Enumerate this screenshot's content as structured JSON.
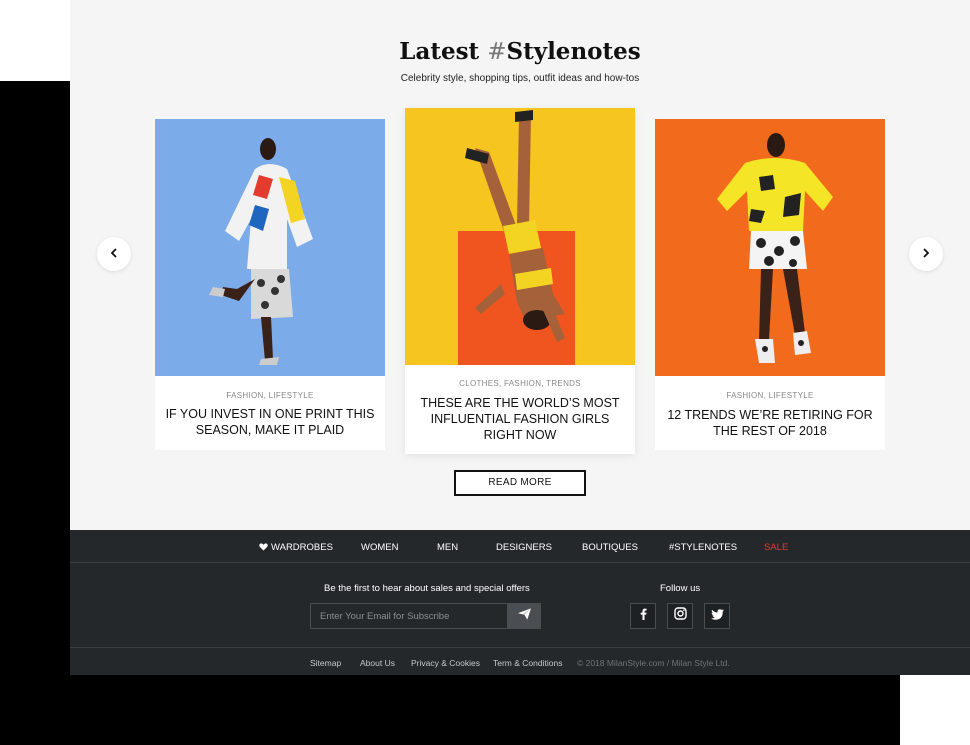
{
  "section": {
    "heading_main": "Latest ",
    "heading_hash": "#",
    "heading_word": "Stylenotes",
    "subheading": "Celebrity style, shopping tips, outfit ideas and how-tos"
  },
  "carousel": {
    "cards": [
      {
        "categories": "FASHION, LIFESTYLE",
        "title": "IF YOU INVEST IN ONE PRINT THIS SEASON, MAKE IT PLAID"
      },
      {
        "categories": "CLOTHES, FASHION, TRENDS",
        "title": "THESE ARE THE WORLD’S MOST INFLUENTIAL FASHION GIRLS RIGHT NOW"
      },
      {
        "categories": "FASHION, LIFESTYLE",
        "title": "12 TRENDS WE’RE RETIRING FOR THE REST OF 2018"
      }
    ],
    "prev_icon": "chevron-left-icon",
    "next_icon": "chevron-right-icon"
  },
  "read_more_label": "READ MORE",
  "footer": {
    "nav": [
      {
        "label": "WARDROBES",
        "icon": "heart-icon"
      },
      {
        "label": "WOMEN"
      },
      {
        "label": "MEN"
      },
      {
        "label": "DESIGNERS"
      },
      {
        "label": "BOUTIQUES"
      },
      {
        "label": "#STYLENOTES"
      },
      {
        "label": "SALE",
        "color": "#e53935"
      }
    ],
    "newsletter_label": "Be the first to hear about sales and special offers",
    "email_placeholder": "Enter Your Email for Subscribe",
    "email_value": "",
    "send_icon": "paper-plane-icon",
    "follow_label": "Follow us",
    "social": [
      "facebook-icon",
      "instagram-icon",
      "twitter-icon"
    ],
    "links": [
      "Sitemap",
      "About Us",
      "Privacy & Cookies",
      "Term & Conditions"
    ],
    "copyright": "© 2018 MilanStyle.com / Milan Style Ltd."
  },
  "colors": {
    "card1_bg": "#7cabe9",
    "card2_bg": "#f7c51f",
    "card3_bg": "#f26a1c",
    "footer_bg": "#25282b",
    "sale": "#e53935"
  }
}
